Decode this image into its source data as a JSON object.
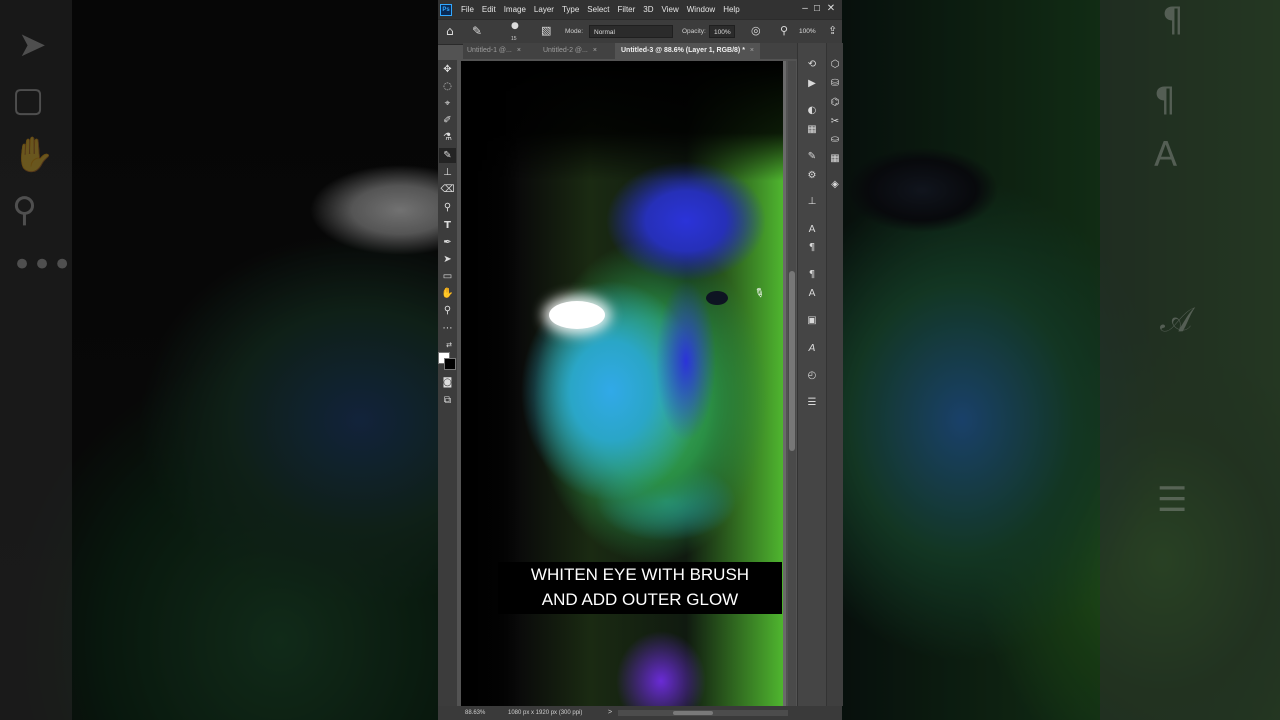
{
  "app": {
    "name": "Photoshop",
    "logo_text": "Ps"
  },
  "menu": [
    "File",
    "Edit",
    "Image",
    "Layer",
    "Type",
    "Select",
    "Filter",
    "3D",
    "View",
    "Window",
    "Help"
  ],
  "window_controls": {
    "minimize": "–",
    "maximize": "☐",
    "close": "✕"
  },
  "options_bar": {
    "home_icon": "home-icon",
    "tool_icon": "brush-icon",
    "brush_size": "15",
    "mode_label": "Mode:",
    "mode_value": "Normal",
    "opacity_label": "Opacity:",
    "opacity_value": "100%",
    "zoom_value": "100%"
  },
  "tabs": [
    {
      "label": "Untitled-1 @...",
      "close": "×"
    },
    {
      "label": "Untitled-2 @...",
      "close": "×"
    },
    {
      "label": "Untitled-3 @ 88.6% (Layer 1, RGB/8) *",
      "close": "×"
    }
  ],
  "tools": [
    "move-tool",
    "lasso-tool",
    "polygonal-lasso-tool",
    "quick-selection-tool",
    "eyedropper-tool",
    "brush-tool",
    "clone-stamp-tool",
    "eraser-tool",
    "dodge-tool",
    "type-tool",
    "pen-tool",
    "path-selection-tool",
    "rectangle-tool",
    "hand-tool",
    "zoom-tool",
    "more-tools"
  ],
  "caption": {
    "line1": "WHITEN EYE WITH BRUSH",
    "line2": "AND ADD OUTER GLOW"
  },
  "statusbar": {
    "zoom": "88.63%",
    "doc_info": "1080 px x 1920 px (300 ppi)",
    "arrow": ">"
  },
  "colors": {
    "accent": "#31a8ff",
    "ui_dark": "#323232",
    "ui_mid": "#535353",
    "canvas_green": "#3eb36a",
    "canvas_blue": "#2b33d9"
  }
}
